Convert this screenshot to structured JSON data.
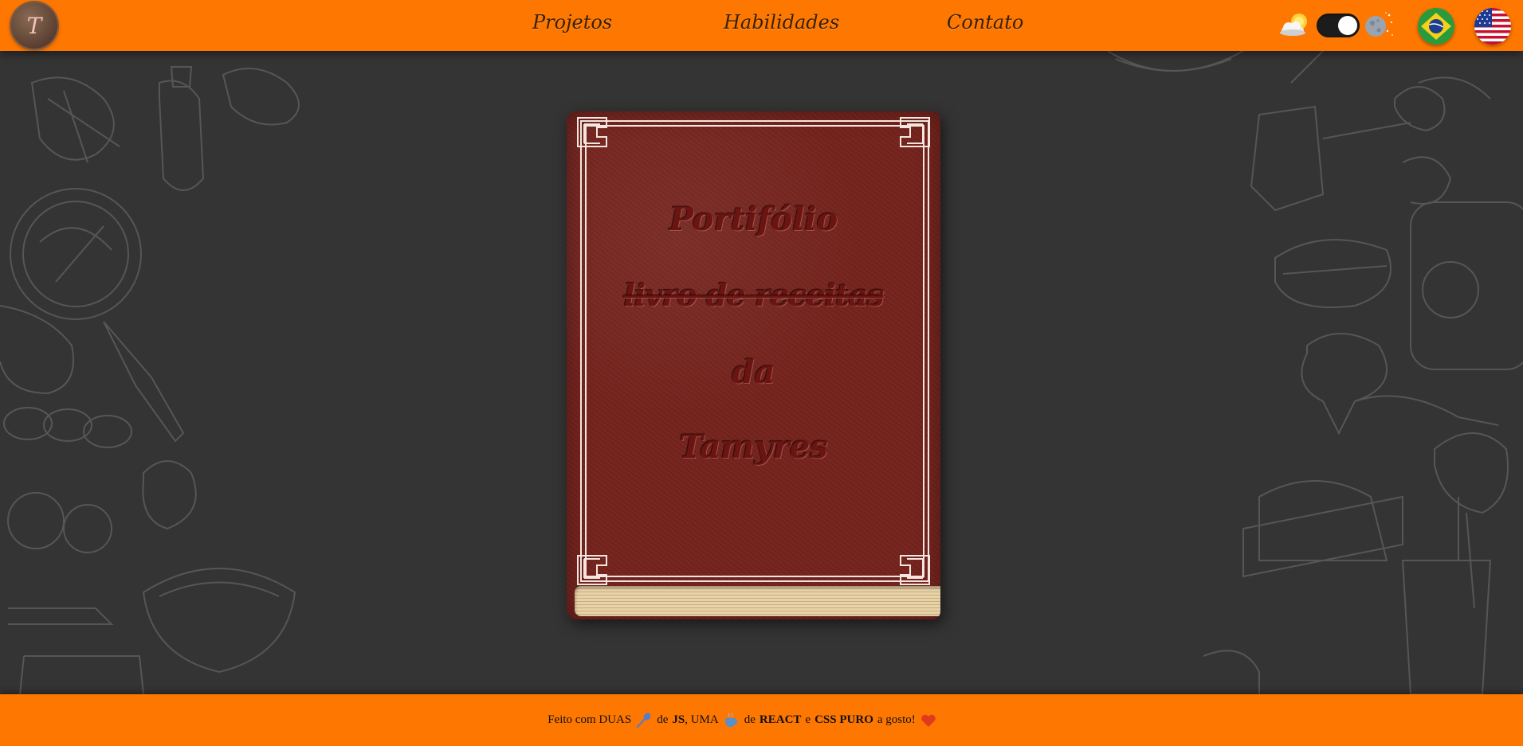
{
  "header": {
    "logo_letter": "T",
    "nav": [
      "Projetos",
      "Habilidades",
      "Contato"
    ],
    "theme_toggle": {
      "state": "dark"
    },
    "languages": [
      "pt-BR",
      "en-US"
    ]
  },
  "book": {
    "line1": "Portifólio",
    "line2_struck": "livro de receitas",
    "line3": "da",
    "line4": "Tamyres"
  },
  "footer": {
    "p1": "Feito com DUAS",
    "p2": "de",
    "js": "JS",
    "p3": ", UMA",
    "p4": "de",
    "react": "REACT",
    "p5": "e",
    "css": "CSS PURO",
    "p6": "a gosto!"
  },
  "icons": {
    "footer": [
      "spoon-icon",
      "cup-icon",
      "heart-icon"
    ],
    "header": [
      "sun-cloud-icon",
      "moon-stars-icon",
      "flag-brazil-icon",
      "flag-usa-icon"
    ]
  },
  "colors": {
    "header_footer": "#fe7700",
    "background": "#343434",
    "book_cover": "#7a2620",
    "title_ink": "#6b1412",
    "heart": "#e03a1e",
    "spoon": "#5a7cc4"
  }
}
